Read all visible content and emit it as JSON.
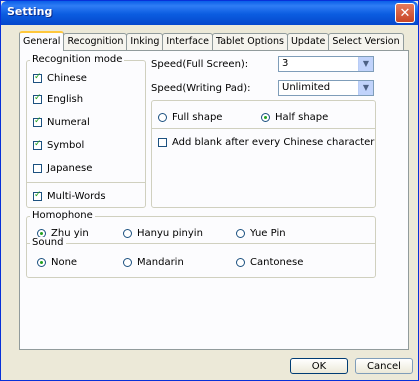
{
  "window": {
    "title": "Setting",
    "close_glyph": "✕"
  },
  "tabs": [
    {
      "label": "General"
    },
    {
      "label": "Recognition"
    },
    {
      "label": "Inking"
    },
    {
      "label": "Interface"
    },
    {
      "label": "Tablet Options"
    },
    {
      "label": "Update"
    },
    {
      "label": "Select Version"
    }
  ],
  "recognition_mode": {
    "legend": "Recognition mode",
    "items": [
      {
        "label": "Chinese",
        "checked": true
      },
      {
        "label": "English",
        "checked": true
      },
      {
        "label": "Numeral",
        "checked": true
      },
      {
        "label": "Symbol",
        "checked": true
      },
      {
        "label": "Japanese",
        "checked": false
      }
    ],
    "multi_words": {
      "label": "Multi-Words",
      "checked": true
    }
  },
  "speed": {
    "full_screen_label": "Speed(Full Screen):",
    "full_screen_value": "3",
    "writing_pad_label": "Speed(Writing Pad):",
    "writing_pad_value": "Unlimited"
  },
  "shape": {
    "full_label": "Full shape",
    "half_label": "Half shape",
    "selected": "half"
  },
  "add_blank": {
    "label": "Add blank after every Chinese character",
    "checked": false
  },
  "homophone": {
    "legend": "Homophone",
    "options": [
      {
        "label": "Zhu yin",
        "checked": true
      },
      {
        "label": "Hanyu pinyin",
        "checked": false
      },
      {
        "label": "Yue Pin",
        "checked": false
      }
    ]
  },
  "sound": {
    "legend": "Sound",
    "options": [
      {
        "label": "None",
        "checked": true
      },
      {
        "label": "Mandarin",
        "checked": false
      },
      {
        "label": "Cantonese",
        "checked": false
      }
    ]
  },
  "buttons": {
    "ok": "OK",
    "cancel": "Cancel"
  }
}
